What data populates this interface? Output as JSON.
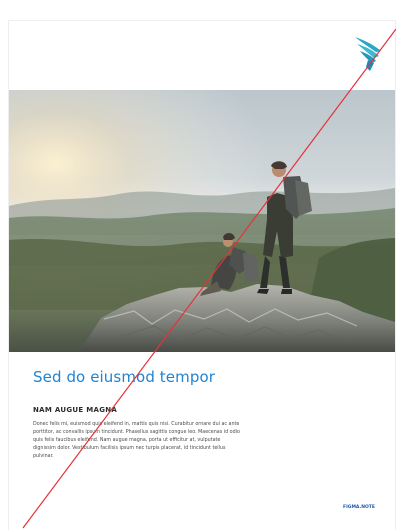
{
  "document": {
    "headline": "Sed do eiusmod tempor",
    "subheadline": "NAM AUGUE MAGNA",
    "body": "Donec felis mi, euismod quis eleifend in, mattis quis nisi. Curabitur ornare dui ac ante porttitor, ac convallis ipsum tincidunt. Phasellus sagittis congue leo. Maecenas id odio quis felis faucibus eleifend. Nam augue magna, porta ut efficitur at, vulputate dignissim dolor. Vestibulum facilisis ipsum nec turpis placerat, id tincidunt tellus pulvinar.",
    "footer_mark": "FIGMA.NOTE"
  },
  "colors": {
    "accent_blue": "#1f83d4",
    "logo_teal": "#27a8c4",
    "strike_red": "#e5323b",
    "footer_blue": "#1d5aa8"
  },
  "icons": {
    "logo": "bird-wing-logo-icon"
  }
}
